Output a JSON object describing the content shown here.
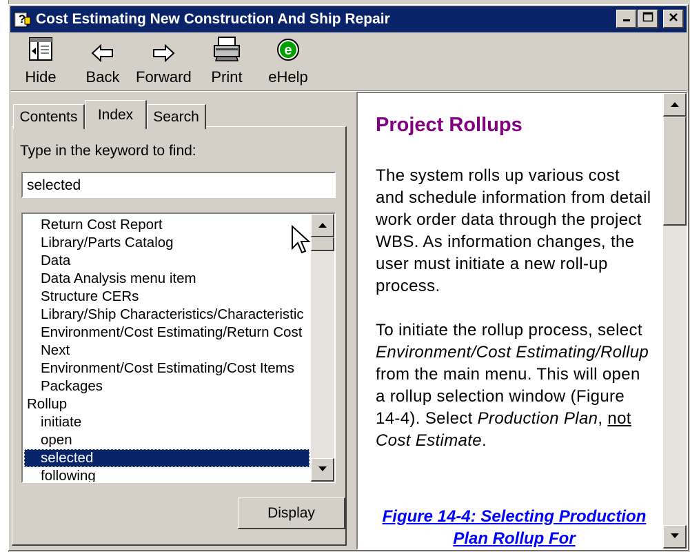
{
  "window": {
    "title": "Cost Estimating New Construction And Ship Repair"
  },
  "toolbar": {
    "hide": "Hide",
    "back": "Back",
    "forward": "Forward",
    "print": "Print",
    "ehelp": "eHelp"
  },
  "tabs": {
    "contents": "Contents",
    "index": "Index",
    "search": "Search",
    "active": "Index"
  },
  "index_panel": {
    "keyword_label": "Type in the keyword to find:",
    "keyword_value": "selected",
    "items": [
      {
        "text": "Return Cost Report",
        "level": 1
      },
      {
        "text": "Library/Parts Catalog",
        "level": 1
      },
      {
        "text": "Data",
        "level": 1
      },
      {
        "text": "Data Analysis menu item",
        "level": 1
      },
      {
        "text": "Structure CERs",
        "level": 1
      },
      {
        "text": "Library/Ship Characteristics/Characteristic",
        "level": 1
      },
      {
        "text": "Environment/Cost Estimating/Return Cost",
        "level": 1
      },
      {
        "text": "Next",
        "level": 1
      },
      {
        "text": "Environment/Cost Estimating/Cost Items",
        "level": 1
      },
      {
        "text": "Packages",
        "level": 1
      },
      {
        "text": "Rollup",
        "level": 0
      },
      {
        "text": "initiate",
        "level": 1
      },
      {
        "text": "open",
        "level": 1
      },
      {
        "text": "selected",
        "level": 1,
        "selected": true
      },
      {
        "text": "following",
        "level": 1
      }
    ],
    "display_button": "Display"
  },
  "topic": {
    "heading": "Project Rollups",
    "para1": "The system rolls up various cost and schedule information from detail work order data through the project WBS.  As information changes, the user must initiate a new roll-up process.",
    "para2_lines": [
      "To initiate the rollup process,",
      "select ",
      "Environment/Cost",
      "Estimating/Rollup",
      " from the main",
      "menu.  This will open a rollup",
      "selection window (Figure 14-4).",
      "Select ",
      "Production Plan",
      ", ",
      "not",
      " Cost",
      "Estimate",
      "."
    ],
    "figure_link": "Figure 14-4: Selecting Production Plan Rollup For"
  },
  "colors": {
    "title_bar": "#0a246a",
    "heading": "#800080",
    "link": "#0000ff",
    "selection": "#0a246a"
  }
}
